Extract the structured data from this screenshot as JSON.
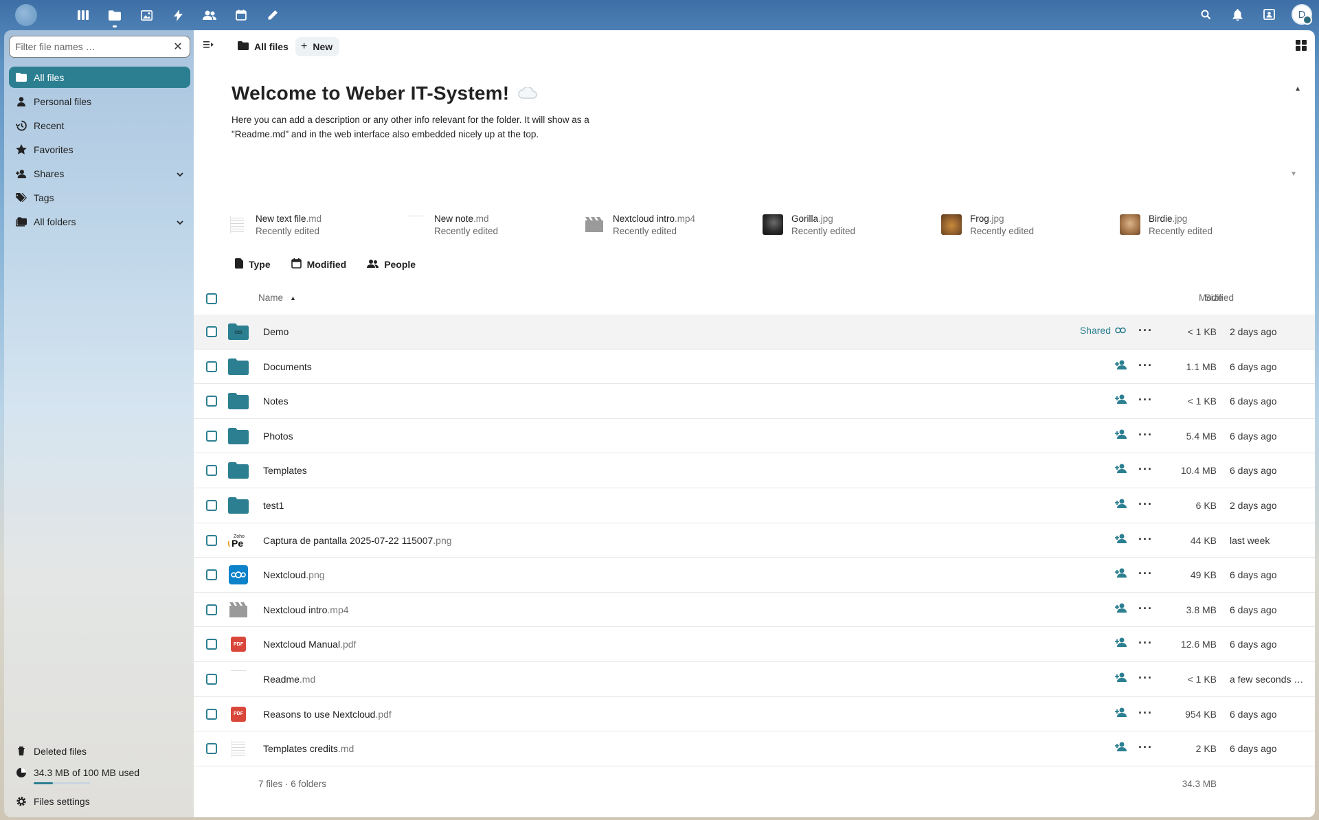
{
  "header": {
    "apps": [
      "dashboard-icon",
      "files-icon",
      "photos-icon",
      "activity-icon",
      "contacts-icon",
      "calendar-icon",
      "notes-icon"
    ],
    "right": [
      "search-icon",
      "bell-icon",
      "contacts-menu-icon"
    ],
    "avatar_letter": "D"
  },
  "sidebar": {
    "filter_placeholder": "Filter file names …",
    "items": [
      {
        "label": "All files",
        "icon": "folder-icon",
        "active": true
      },
      {
        "label": "Personal files",
        "icon": "account-icon"
      },
      {
        "label": "Recent",
        "icon": "history-icon"
      },
      {
        "label": "Favorites",
        "icon": "star-icon"
      },
      {
        "label": "Shares",
        "icon": "share-icon",
        "chevron": true
      },
      {
        "label": "Tags",
        "icon": "tag-icon"
      },
      {
        "label": "All folders",
        "icon": "folder-multiple-icon",
        "chevron": true
      }
    ],
    "deleted": "Deleted files",
    "quota": "34.3 MB of 100 MB used",
    "quota_fraction": 0.343,
    "settings": "Files settings"
  },
  "toolbar": {
    "breadcrumb": "All files",
    "new_label": "New"
  },
  "readme": {
    "title": "Welcome to Weber IT-System!",
    "line1": "Here you can add a description or any other info relevant for the folder. It will show as a",
    "line2": "\"Readme.md\" and in the web interface also embedded nicely up at the top."
  },
  "recent": [
    {
      "name": "New text file",
      "ext": ".md",
      "sub": "Recently edited",
      "kind": "doc"
    },
    {
      "name": "New note",
      "ext": ".md",
      "sub": "Recently edited",
      "kind": "blank"
    },
    {
      "name": "Nextcloud intro",
      "ext": ".mp4",
      "sub": "Recently edited",
      "kind": "video"
    },
    {
      "name": "Gorilla",
      "ext": ".jpg",
      "sub": "Recently edited",
      "kind": "img-dark"
    },
    {
      "name": "Frog",
      "ext": ".jpg",
      "sub": "Recently edited",
      "kind": "img-orange"
    },
    {
      "name": "Birdie",
      "ext": ".jpg",
      "sub": "Recently edited",
      "kind": "img-brown"
    }
  ],
  "filters": [
    "Type",
    "Modified",
    "People"
  ],
  "table": {
    "col_name": "Name",
    "col_size": "Size",
    "col_modified": "Modified",
    "rows": [
      {
        "name": "Demo",
        "ext": "",
        "size": "< 1 KB",
        "modified": "2 days ago",
        "kind": "folder-link",
        "shared": "Shared"
      },
      {
        "name": "Documents",
        "ext": "",
        "size": "1.1 MB",
        "modified": "6 days ago",
        "kind": "folder"
      },
      {
        "name": "Notes",
        "ext": "",
        "size": "< 1 KB",
        "modified": "6 days ago",
        "kind": "folder"
      },
      {
        "name": "Photos",
        "ext": "",
        "size": "5.4 MB",
        "modified": "6 days ago",
        "kind": "folder"
      },
      {
        "name": "Templates",
        "ext": "",
        "size": "10.4 MB",
        "modified": "6 days ago",
        "kind": "folder"
      },
      {
        "name": "test1",
        "ext": "",
        "size": "6 KB",
        "modified": "2 days ago",
        "kind": "folder"
      },
      {
        "name": "Captura de pantalla 2025-07-22 115007",
        "ext": ".png",
        "size": "44 KB",
        "modified": "last week",
        "kind": "zoho"
      },
      {
        "name": "Nextcloud",
        "ext": ".png",
        "size": "49 KB",
        "modified": "6 days ago",
        "kind": "nc"
      },
      {
        "name": "Nextcloud intro",
        "ext": ".mp4",
        "size": "3.8 MB",
        "modified": "6 days ago",
        "kind": "video"
      },
      {
        "name": "Nextcloud Manual",
        "ext": ".pdf",
        "size": "12.6 MB",
        "modified": "6 days ago",
        "kind": "pdf"
      },
      {
        "name": "Readme",
        "ext": ".md",
        "size": "< 1 KB",
        "modified": "a few seconds …",
        "kind": "blank"
      },
      {
        "name": "Reasons to use Nextcloud",
        "ext": ".pdf",
        "size": "954 KB",
        "modified": "6 days ago",
        "kind": "pdf"
      },
      {
        "name": "Templates credits",
        "ext": ".md",
        "size": "2 KB",
        "modified": "6 days ago",
        "kind": "doc"
      }
    ],
    "summary": "7 files · 6 folders",
    "total": "34.3 MB"
  },
  "colors": {
    "accent": "#2c7f91",
    "pdf": "#d9473a"
  }
}
